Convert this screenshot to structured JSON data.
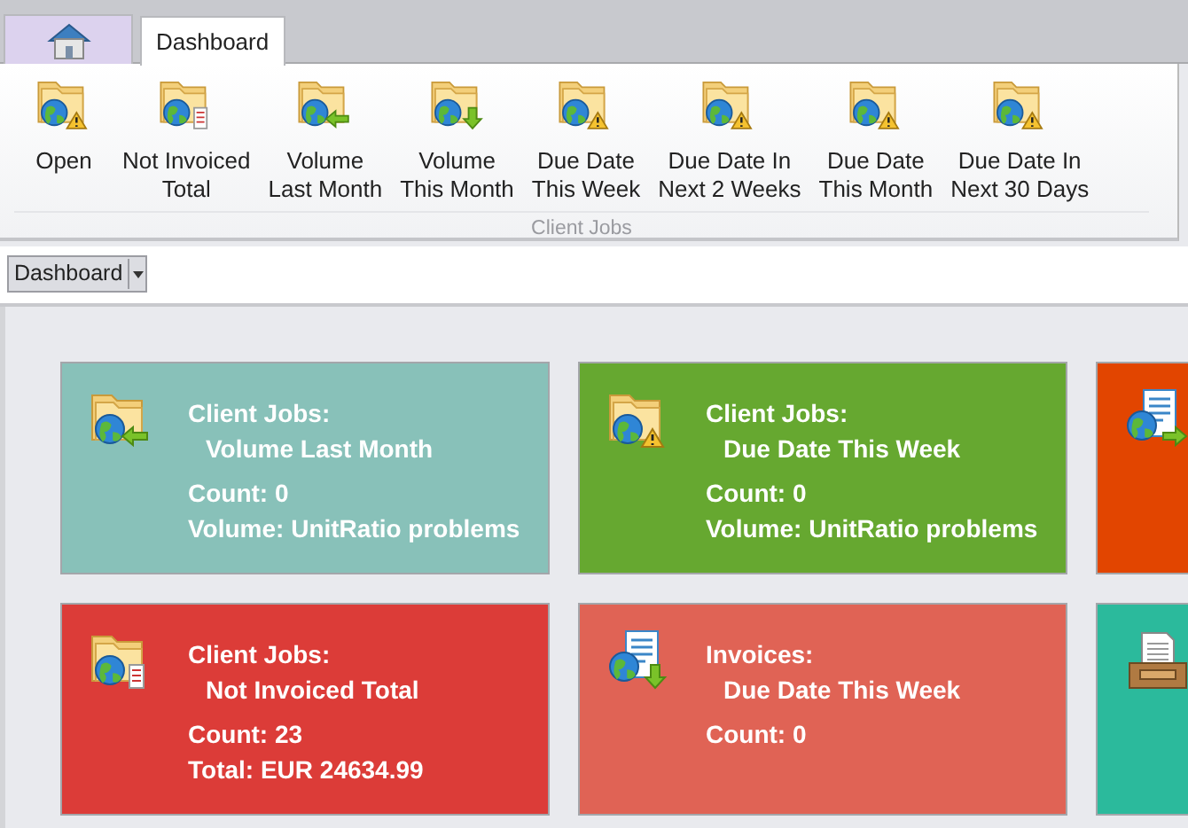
{
  "tabs": [
    {
      "kind": "home",
      "selected": false
    },
    {
      "label": "Dashboard",
      "selected": true
    }
  ],
  "ribbon": {
    "buttons": [
      {
        "label": [
          "Open"
        ],
        "kind": "warning"
      },
      {
        "label": [
          "Not Invoiced",
          "Total"
        ],
        "kind": "invoice"
      },
      {
        "label": [
          "Volume",
          "Last Month"
        ],
        "kind": "back"
      },
      {
        "label": [
          "Volume",
          "This Month"
        ],
        "kind": "down"
      },
      {
        "label": [
          "Due Date",
          "This Week"
        ],
        "kind": "warning"
      },
      {
        "label": [
          "Due Date In",
          "Next 2 Weeks"
        ],
        "kind": "warning"
      },
      {
        "label": [
          "Due Date",
          "This Month"
        ],
        "kind": "warning"
      },
      {
        "label": [
          "Due Date In",
          "Next 30 Days"
        ],
        "kind": "warning"
      }
    ],
    "group_label": "Client Jobs"
  },
  "toolbar": {
    "dropdown": "Dashboard"
  },
  "tiles": [
    {
      "color": "#88c1b9",
      "kind": "back",
      "title": "Client Jobs:",
      "subtitle": "Volume Last Month",
      "lines": [
        "Count: 0",
        "Volume: UnitRatio problems"
      ]
    },
    {
      "color": "#66a830",
      "kind": "warning",
      "title": "Client Jobs:",
      "subtitle": "Due Date This Week",
      "lines": [
        "Count: 0",
        "Volume: UnitRatio problems"
      ]
    },
    {
      "color": "#e24500",
      "kind": "doc-forward"
    },
    {
      "color": "#dc3c38",
      "kind": "invoice",
      "title": "Client Jobs:",
      "subtitle": "Not Invoiced Total",
      "lines": [
        "Count: 23",
        "Total: EUR 24634.99"
      ]
    },
    {
      "color": "#e06355",
      "kind": "doc-down",
      "title": "Invoices:",
      "subtitle": "Due Date This Week",
      "lines": [
        "Count: 0"
      ]
    },
    {
      "color": "#2bba9c",
      "kind": "tray"
    }
  ]
}
